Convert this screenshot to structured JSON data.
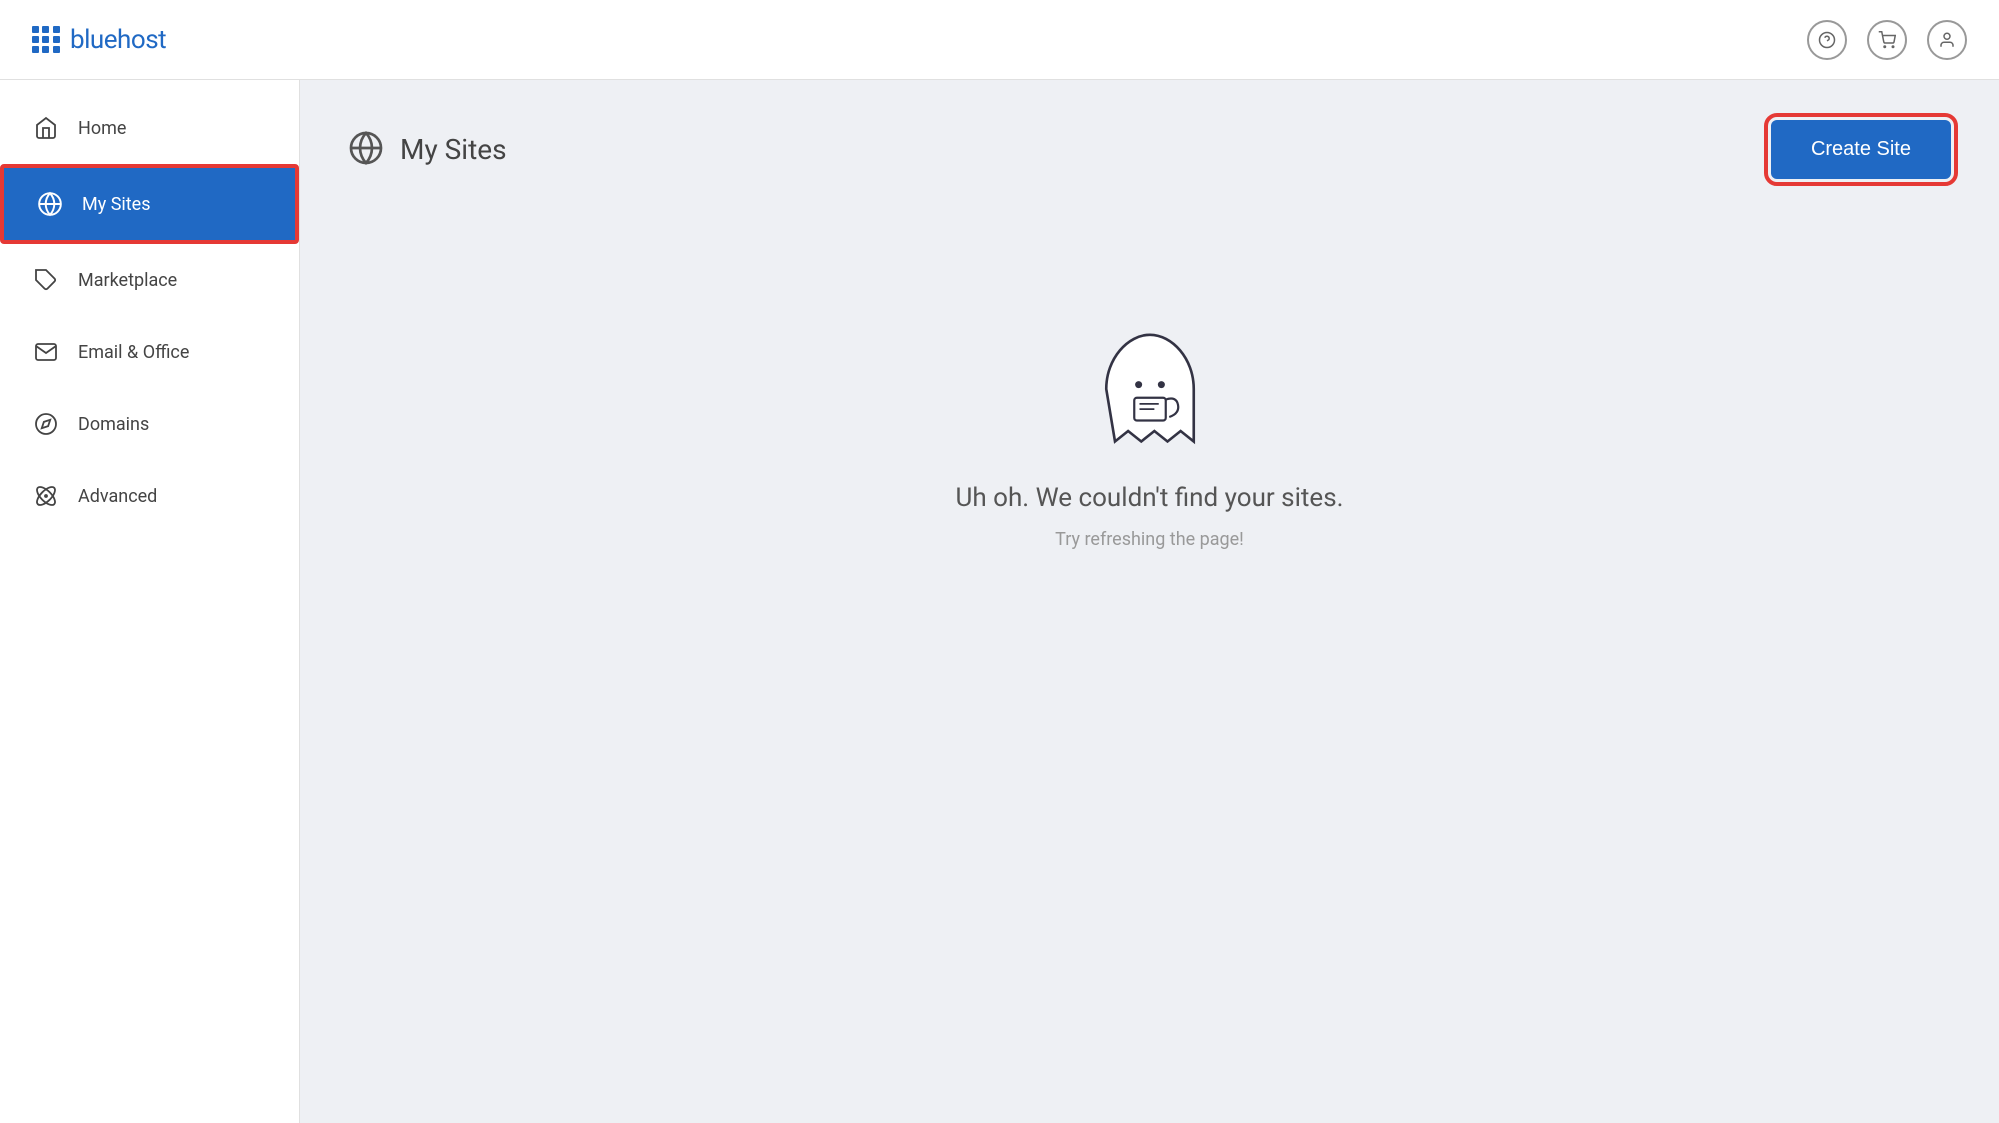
{
  "header": {
    "logo_text": "bluehost",
    "icons": {
      "help": "?",
      "cart": "🛒",
      "user": "👤"
    }
  },
  "sidebar": {
    "items": [
      {
        "id": "home",
        "label": "Home",
        "icon": "home"
      },
      {
        "id": "my-sites",
        "label": "My Sites",
        "icon": "wp",
        "active": true
      },
      {
        "id": "marketplace",
        "label": "Marketplace",
        "icon": "tag"
      },
      {
        "id": "email-office",
        "label": "Email & Office",
        "icon": "mail"
      },
      {
        "id": "domains",
        "label": "Domains",
        "icon": "compass"
      },
      {
        "id": "advanced",
        "label": "Advanced",
        "icon": "atom"
      }
    ]
  },
  "main": {
    "page_title": "My Sites",
    "create_site_label": "Create Site",
    "empty_state": {
      "title": "Uh oh. We couldn't find your sites.",
      "subtitle": "Try refreshing the page!"
    }
  }
}
